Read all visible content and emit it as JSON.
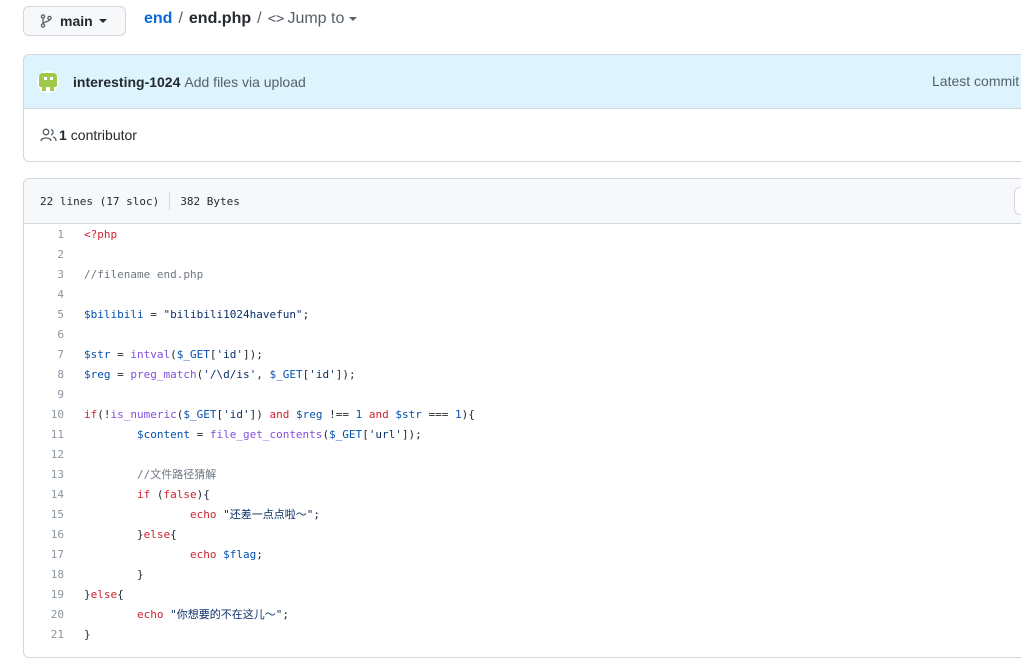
{
  "branch": {
    "label": "main",
    "icon": "git-branch-icon"
  },
  "breadcrumb": {
    "repo": "end",
    "separator": "/",
    "file": "end.php",
    "jump_label": "Jump to"
  },
  "commit": {
    "author": "interesting-1024",
    "message": "Add files via upload",
    "latest_label": "Latest commit"
  },
  "contributors": {
    "count": "1",
    "label": "contributor"
  },
  "file": {
    "lines_info": "22 lines (17 sloc)",
    "size": "382 Bytes"
  },
  "code_lines": [
    {
      "n": "1",
      "t": "<?php"
    },
    {
      "n": "2",
      "t": ""
    },
    {
      "n": "3",
      "t": "//filename end.php"
    },
    {
      "n": "4",
      "t": ""
    },
    {
      "n": "5",
      "t": "$bilibili = \"bilibili1024havefun\";"
    },
    {
      "n": "6",
      "t": ""
    },
    {
      "n": "7",
      "t": "$str = intval($_GET['id']);"
    },
    {
      "n": "8",
      "t": "$reg = preg_match('/\\d/is', $_GET['id']);"
    },
    {
      "n": "9",
      "t": ""
    },
    {
      "n": "10",
      "t": "if(!is_numeric($_GET['id']) and $reg !== 1 and $str === 1){"
    },
    {
      "n": "11",
      "t": "        $content = file_get_contents($_GET['url']);"
    },
    {
      "n": "12",
      "t": ""
    },
    {
      "n": "13",
      "t": "        //文件路径猜解"
    },
    {
      "n": "14",
      "t": "        if (false){"
    },
    {
      "n": "15",
      "t": "                echo \"还差一点点啦～\";"
    },
    {
      "n": "16",
      "t": "        }else{"
    },
    {
      "n": "17",
      "t": "                echo $flag;"
    },
    {
      "n": "18",
      "t": "        }"
    },
    {
      "n": "19",
      "t": "}else{"
    },
    {
      "n": "20",
      "t": "        echo \"你想要的不在这儿～\";"
    },
    {
      "n": "21",
      "t": "}"
    }
  ],
  "colors": {
    "link": "#0969da",
    "commit_bg": "#ddf4ff",
    "avatar": "#a0c84a",
    "keyword": "#cf222e",
    "function": "#8250df",
    "variable": "#0550ae",
    "string": "#0a3069",
    "comment": "#6e7781"
  }
}
